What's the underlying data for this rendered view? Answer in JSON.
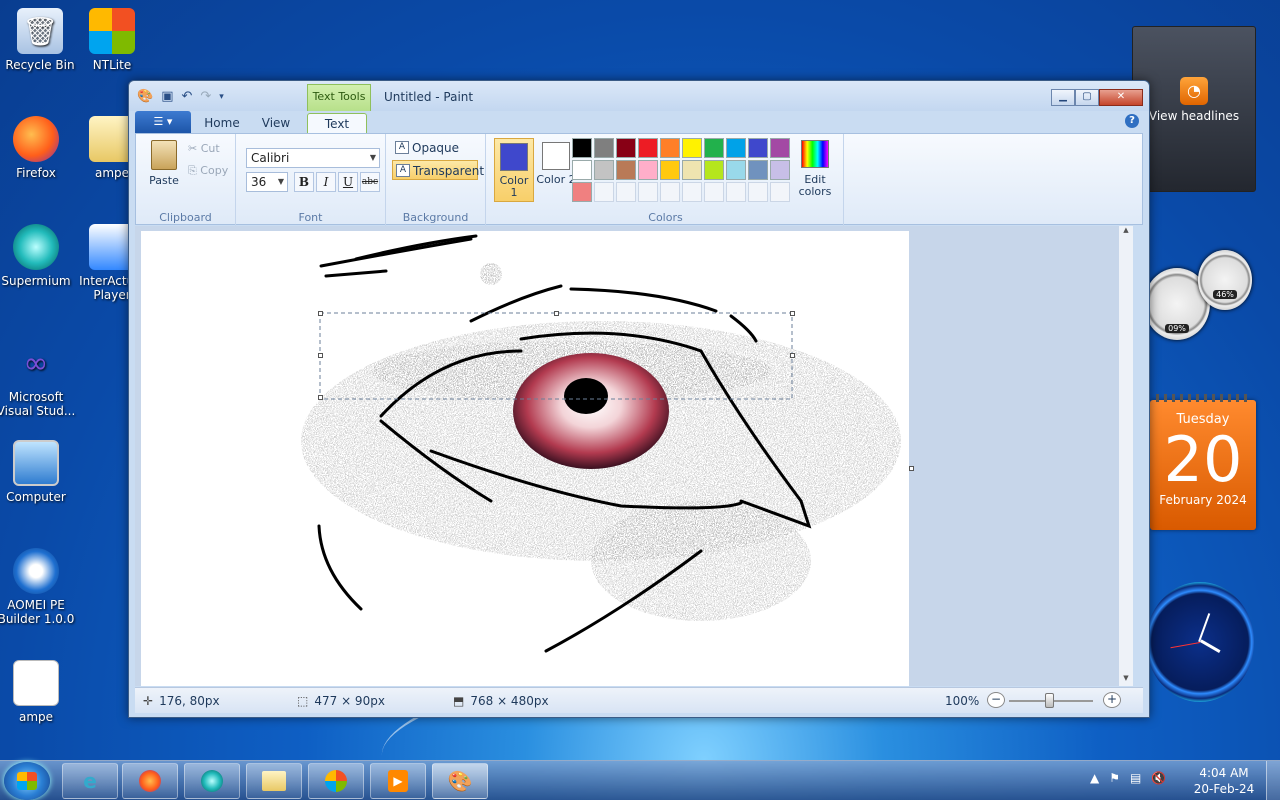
{
  "desktop": {
    "icons": [
      {
        "label": "Recycle Bin",
        "icon": "recycle-bin-icon"
      },
      {
        "label": "NTLite",
        "icon": "ntlite-icon"
      },
      {
        "label": "Firefox",
        "icon": "firefox-icon"
      },
      {
        "label": "ampe",
        "icon": "folder-icon"
      },
      {
        "label": "Supermium",
        "icon": "supermium-icon"
      },
      {
        "label": "InterActual Player",
        "icon": "interactual-player-icon"
      },
      {
        "label": "Microsoft Visual Stud...",
        "icon": "visual-studio-icon"
      },
      {
        "label": "Computer",
        "icon": "computer-icon"
      },
      {
        "label": "AOMEI PE Builder 1.0.0",
        "icon": "aomei-icon"
      },
      {
        "label": "ampe",
        "icon": "disc-file-icon"
      }
    ]
  },
  "window": {
    "title": "Untitled - Paint",
    "context_tab": "Text Tools",
    "tabs": [
      "Home",
      "View",
      "Text"
    ],
    "active_tab": "Text"
  },
  "ribbon": {
    "clipboard": {
      "paste": "Paste",
      "cut": "Cut",
      "copy": "Copy",
      "label": "Clipboard"
    },
    "font": {
      "family": "Calibri",
      "size": "36",
      "bold": "B",
      "italic": "I",
      "underline": "U",
      "strike": "abc",
      "label": "Font"
    },
    "background": {
      "opaque": "Opaque",
      "transparent": "Transparent",
      "selected": "Transparent",
      "label": "Background"
    },
    "colors": {
      "color1_label": "Color 1",
      "color2_label": "Color 2",
      "color1": "#3f48cc",
      "color2": "#ffffff",
      "edit_label": "Edit colors",
      "label": "Colors",
      "palette_row1": [
        "#000000",
        "#7f7f7f",
        "#880015",
        "#ed1c24",
        "#ff7f27",
        "#fff200",
        "#22b14c",
        "#00a2e8",
        "#3f48cc",
        "#a349a4"
      ],
      "palette_row2": [
        "#ffffff",
        "#c3c3c3",
        "#b97a57",
        "#ffaec9",
        "#ffc90e",
        "#efe4b0",
        "#b5e61d",
        "#99d9ea",
        "#7092be",
        "#c8bfe7"
      ],
      "palette_row3": [
        "#f08080"
      ]
    }
  },
  "status": {
    "cursor": "176, 80px",
    "selection": "477 × 90px",
    "canvas_size": "768 × 480px",
    "zoom": "100%"
  },
  "gadgets": {
    "headlines": "View headlines",
    "cpu": "09%",
    "mem": "46%",
    "calendar": {
      "weekday": "Tuesday",
      "day": "20",
      "month": "February 2024"
    }
  },
  "taskbar": {
    "apps": [
      "ie-icon",
      "firefox-icon",
      "supermium-icon",
      "explorer-icon",
      "media-center-icon",
      "media-player-icon",
      "paint-icon"
    ],
    "time": "4:04 AM",
    "date": "20-Feb-24"
  }
}
